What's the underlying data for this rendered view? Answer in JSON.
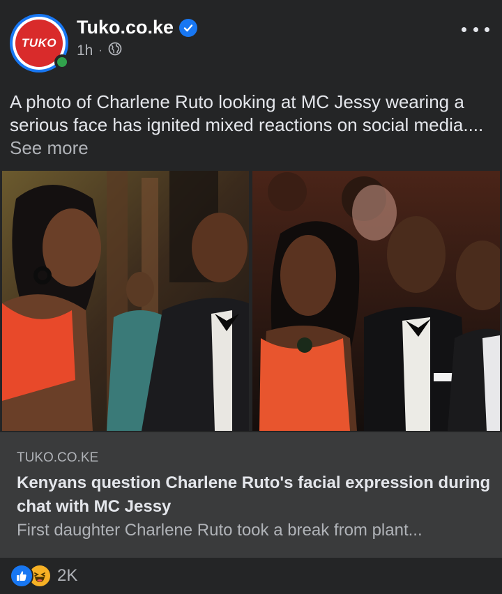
{
  "header": {
    "page_name": "Tuko.co.ke",
    "logo_text": "TUKO",
    "time": "1h",
    "separator": "·",
    "verified_icon": "verified-badge-icon",
    "privacy_icon": "globe-icon",
    "more_icon": "more-dots-icon"
  },
  "post": {
    "caption": "A photo of Charlene Ruto looking at MC Jessy wearing a serious face has ignited mixed reactions on social media....",
    "see_more": "See more"
  },
  "link_preview": {
    "domain": "TUKO.CO.KE",
    "title": "Kenyans question Charlene Ruto's facial expression during chat with MC Jessy",
    "description": "First daughter Charlene Ruto took a break from plant..."
  },
  "reactions": {
    "icons": [
      "like-icon",
      "haha-icon"
    ],
    "count": "2K"
  },
  "colors": {
    "background": "#242526",
    "link_box": "#3a3b3c",
    "accent_blue": "#1877f2",
    "logo_red": "#d92b2b",
    "online_green": "#31a24c",
    "haha_yellow": "#f7b125"
  }
}
